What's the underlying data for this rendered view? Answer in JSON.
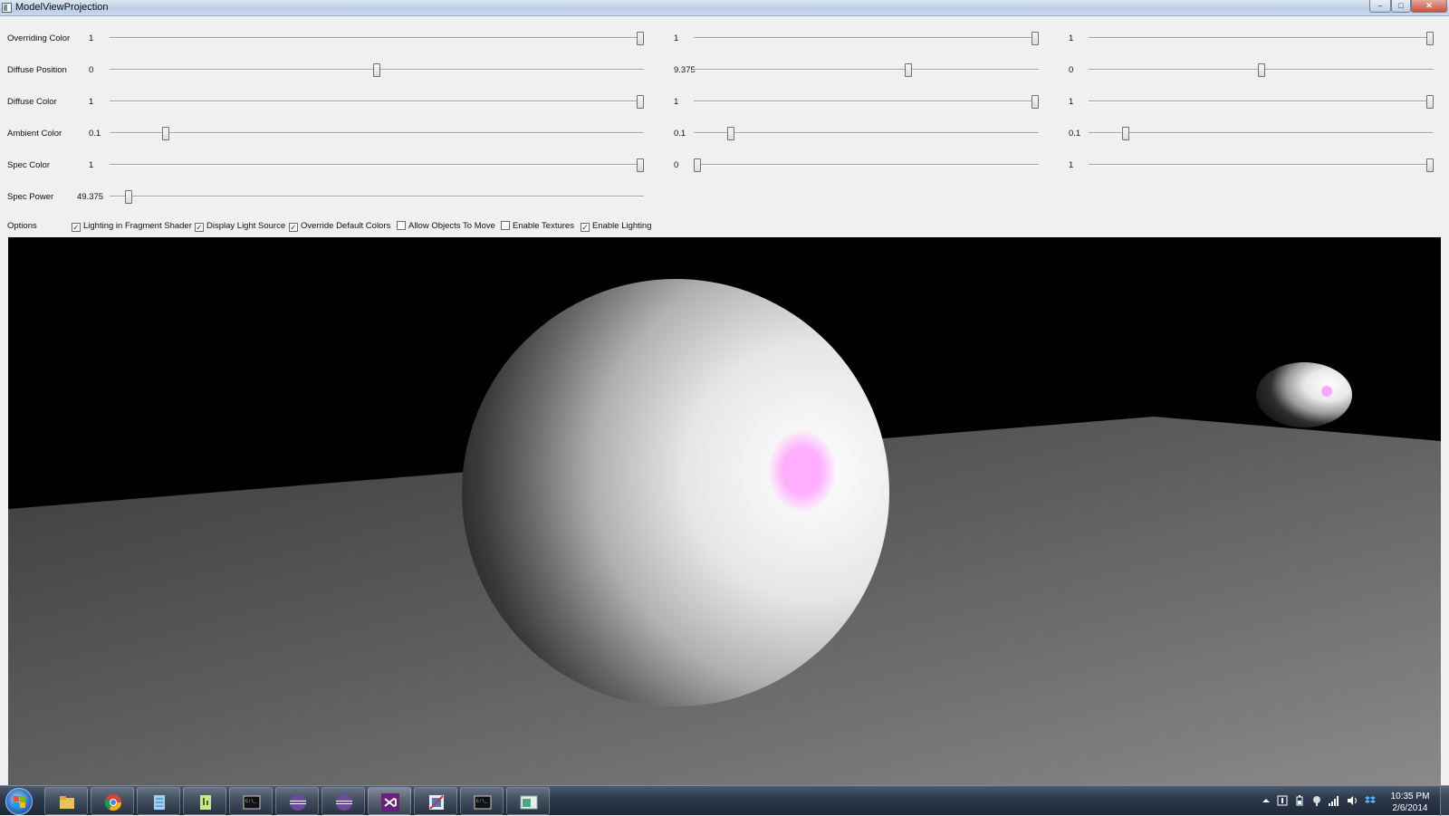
{
  "window": {
    "title": "ModelViewProjection",
    "minimize": "–",
    "maximize": "□",
    "close": "✕"
  },
  "sliders": [
    {
      "label": "Overriding Color",
      "values": [
        "1",
        "1",
        "1"
      ],
      "positions": [
        1.0,
        1.0,
        1.0
      ]
    },
    {
      "label": "Diffuse Position",
      "values": [
        "0",
        "9.375",
        "0"
      ],
      "positions": [
        0.5,
        0.625,
        0.5
      ]
    },
    {
      "label": "Diffuse Color",
      "values": [
        "1",
        "1",
        "1"
      ],
      "positions": [
        1.0,
        1.0,
        1.0
      ]
    },
    {
      "label": "Ambient Color",
      "values": [
        "0.1",
        "0.1",
        "0.1"
      ],
      "positions": [
        0.1,
        0.1,
        0.1
      ]
    },
    {
      "label": "Spec Color",
      "values": [
        "1",
        "0",
        "1"
      ],
      "positions": [
        1.0,
        0.0,
        1.0
      ]
    },
    {
      "label": "Spec Power",
      "values": [
        "49.375"
      ],
      "positions": [
        0.03
      ]
    }
  ],
  "options": {
    "label": "Options",
    "checkboxes": [
      {
        "label": "Lighting in Fragment Shader",
        "checked": true
      },
      {
        "label": "Display Light Source",
        "checked": true
      },
      {
        "label": "Override Default Colors",
        "checked": true
      },
      {
        "label": "Allow Objects To Move",
        "checked": false
      },
      {
        "label": "Enable Textures",
        "checked": false
      },
      {
        "label": "Enable Lighting",
        "checked": true
      }
    ]
  },
  "scene": {
    "background_color": "#000000",
    "floor_color": "#6f6f6f",
    "sphere_color": "#e8e8e8",
    "specular_color": "#ff9cff"
  },
  "taskbar": {
    "apps": [
      "file-explorer-icon",
      "chrome-icon",
      "notepad-icon",
      "notepad-plus-icon",
      "console-icon",
      "eclipse-icon",
      "eclipse-icon",
      "visual-studio-icon",
      "paint-icon",
      "console-icon",
      "app-window-icon"
    ],
    "clock_time": "10:35 PM",
    "clock_date": "2/6/2014"
  }
}
